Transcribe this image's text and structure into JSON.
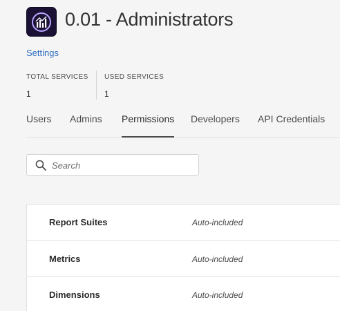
{
  "header": {
    "logo_icon": "analytics-bar-chart-icon",
    "title": "0.01 - Administrators",
    "settings_link": "Settings"
  },
  "stats": [
    {
      "label": "TOTAL SERVICES",
      "value": "1"
    },
    {
      "label": "USED SERVICES",
      "value": "1"
    }
  ],
  "tabs": [
    {
      "label": "Users",
      "active": false
    },
    {
      "label": "Admins",
      "active": false
    },
    {
      "label": "Permissions",
      "active": true
    },
    {
      "label": "Developers",
      "active": false
    },
    {
      "label": "API Credentials",
      "active": false
    }
  ],
  "search": {
    "placeholder": "Search",
    "value": "",
    "icon": "search-icon"
  },
  "permissions": [
    {
      "name": "Report Suites",
      "status": "Auto-included"
    },
    {
      "name": "Metrics",
      "status": "Auto-included"
    },
    {
      "name": "Dimensions",
      "status": "Auto-included"
    }
  ],
  "colors": {
    "link": "#2f6fc0",
    "logo_bg": "#1a1135",
    "logo_accent": "#b9a7ff",
    "background": "#f5f5f5"
  }
}
